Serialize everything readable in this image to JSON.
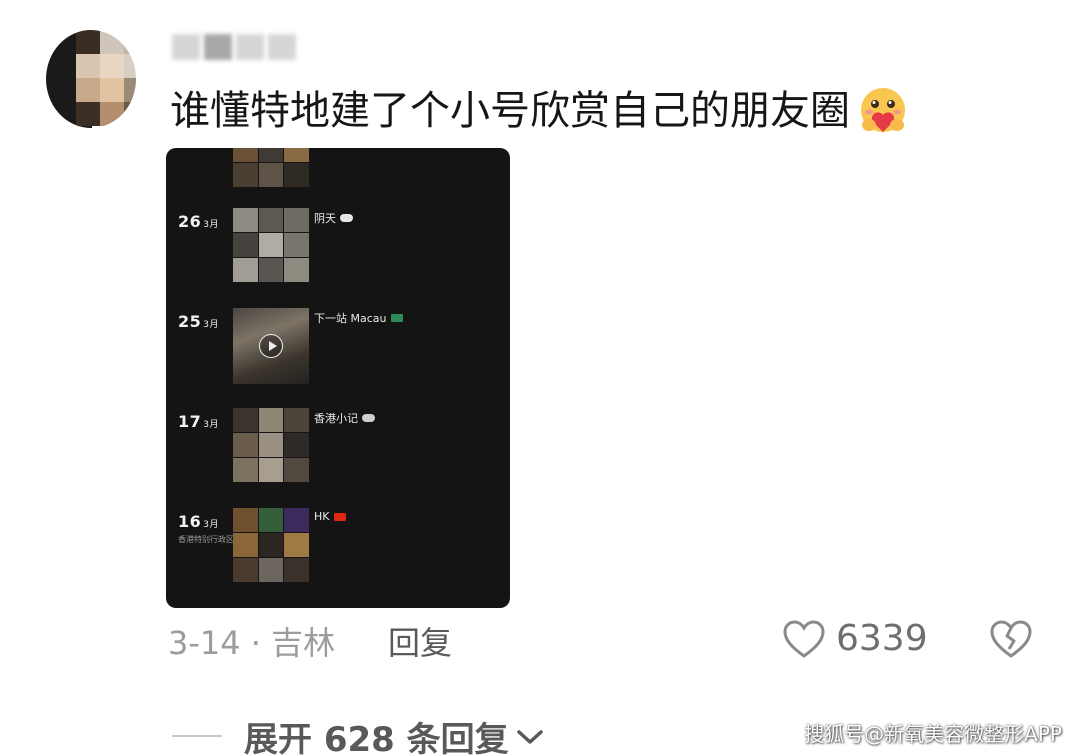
{
  "comment": {
    "avatar_icon": "avatar-icon",
    "text": "谁懂特地建了个小号欣赏自己的朋友圈",
    "emoji": "hugging-heart-emoji",
    "date_location": "3-14 · 吉林",
    "reply_label": "回复",
    "like_count": "6339",
    "expand_label": "展开 628 条回复"
  },
  "screenshot": {
    "entries": [
      {
        "day": "26",
        "month": "3月",
        "caption": "阴天",
        "icon": "cloud-icon"
      },
      {
        "day": "25",
        "month": "3月",
        "caption": "下一站 Macau",
        "icon": "macau-flag-icon"
      },
      {
        "day": "17",
        "month": "3月",
        "caption": "香港小记",
        "icon": "cloud-icon"
      },
      {
        "day": "16",
        "month": "3月",
        "location": "香港特别行政区",
        "caption": "HK",
        "icon": "hk-flag-icon"
      }
    ]
  },
  "watermark": "搜狐号@新氧美容微整形APP",
  "colors": {
    "screenshot_bg": "#141414",
    "meta_gray": "#9c9c9c",
    "macau_flag": "#2e8b57",
    "hk_flag": "#de2910"
  }
}
